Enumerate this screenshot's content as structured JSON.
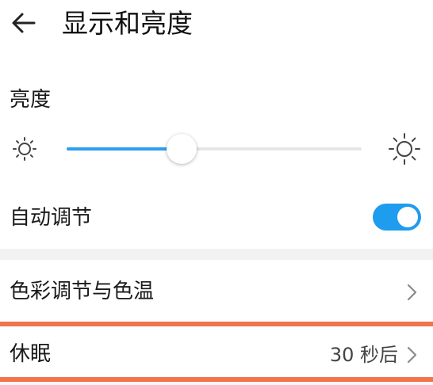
{
  "header": {
    "back_icon": "arrow-left-icon",
    "title": "显示和亮度"
  },
  "brightness": {
    "label": "亮度",
    "level": 0.39,
    "min_icon": "sun-small-icon",
    "max_icon": "sun-large-icon"
  },
  "auto_adjust": {
    "label": "自动调节",
    "enabled": true
  },
  "color_temp": {
    "label": "色彩调节与色温",
    "chevron_icon": "chevron-right-icon"
  },
  "sleep": {
    "label": "休眠",
    "value": "30 秒后",
    "chevron_icon": "chevron-right-icon"
  },
  "colors": {
    "accent": "#2e9ff0",
    "toggle_on": "#1e9cee",
    "highlight": "#f0754f",
    "track": "#e6e6e6",
    "section_gap": "#f2f2f2"
  }
}
